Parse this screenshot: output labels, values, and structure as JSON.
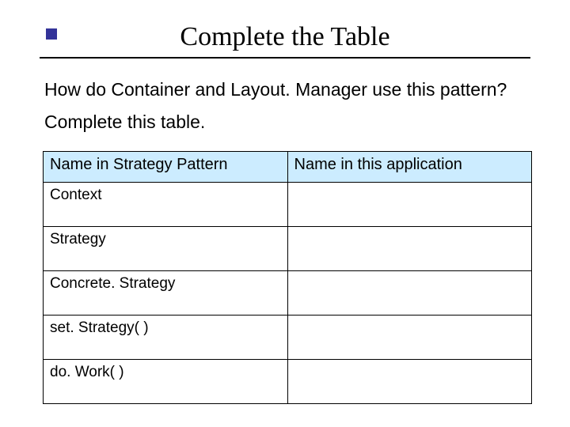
{
  "title": "Complete the Table",
  "body": {
    "line1": "How do Container and Layout. Manager use this pattern?",
    "line2": "Complete this table."
  },
  "table": {
    "headers": [
      "Name in Strategy Pattern",
      "Name in this application"
    ],
    "rows": [
      {
        "left": "Context",
        "right": ""
      },
      {
        "left": "Strategy",
        "right": ""
      },
      {
        "left": "Concrete. Strategy",
        "right": ""
      },
      {
        "left": "set. Strategy( )",
        "right": ""
      },
      {
        "left": "do. Work( )",
        "right": ""
      }
    ]
  }
}
